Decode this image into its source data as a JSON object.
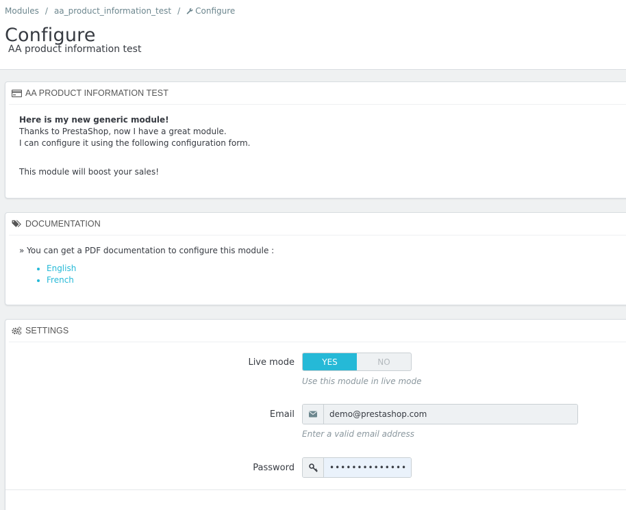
{
  "breadcrumb": {
    "items": [
      "Modules",
      "aa_product_information_test"
    ],
    "separator": "/",
    "current": "Configure"
  },
  "header": {
    "title": "Configure",
    "subtitle": "AA product information test"
  },
  "about_panel": {
    "heading": "AA PRODUCT INFORMATION TEST",
    "lead": "Here is my new generic module!",
    "line1": "Thanks to PrestaShop, now I have a great module.",
    "line2": "I can configure it using the following configuration form.",
    "line3": "This module will boost your sales!"
  },
  "docs_panel": {
    "heading": "DOCUMENTATION",
    "intro": "» You can get a PDF documentation to configure this module :",
    "links": [
      "English",
      "French"
    ]
  },
  "settings_panel": {
    "heading": "SETTINGS",
    "live_mode": {
      "label": "Live mode",
      "yes": "YES",
      "no": "NO",
      "selected": "YES",
      "help": "Use this module in live mode"
    },
    "email": {
      "label": "Email",
      "value": "demo@prestashop.com",
      "help": "Enter a valid email address"
    },
    "password": {
      "label": "Password",
      "value": "••••••••••••••"
    }
  },
  "colors": {
    "accent": "#25b9d7",
    "text": "#363a41",
    "muted": "#8a979e"
  }
}
